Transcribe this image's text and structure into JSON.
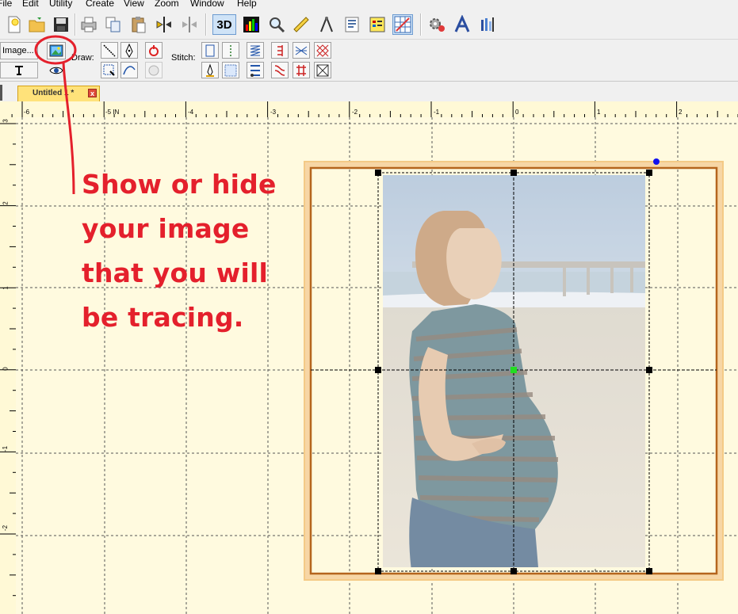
{
  "menu": [
    "File",
    "Edit",
    "Utility",
    "Create",
    "View",
    "Zoom",
    "Window",
    "Help"
  ],
  "toolbar": {
    "toggle_3d_label": "3D",
    "icons": [
      "new-file-icon",
      "open-folder-icon",
      "save-icon",
      "print-icon",
      "copy-icon",
      "paste-icon",
      "mirror-horizontal-icon",
      "mirror-vertical-icon",
      "3d-view-icon",
      "color-chart-icon",
      "zoom-magnifier-icon",
      "ruler-measure-icon",
      "compass-icon",
      "design-info-icon",
      "grid-icon",
      "settings-gear-icon",
      "font-icon",
      "color-pencils-icon"
    ]
  },
  "toolbar2": {
    "image_button_label": "Image...",
    "draw_label": "Draw:",
    "stitch_label": "Stitch:"
  },
  "tab": {
    "title": "Untitled 1 *",
    "close_glyph": "x"
  },
  "ruler": {
    "horizontal_labels": [
      "-6",
      "-5 IN",
      "-4",
      "-3",
      "-2",
      "-1",
      "0",
      "1",
      "2"
    ],
    "vertical_labels": [
      "3",
      "2",
      "1",
      "0",
      "-1",
      "-2"
    ]
  },
  "annotation": {
    "lines": [
      "Show or hide",
      "your image",
      "that you will",
      "be tracing."
    ],
    "color": "#e4202c"
  },
  "colors": {
    "canvas": "#fffadf",
    "hoop_frame": "#f7d6a5",
    "hoop_border": "#b5651d",
    "selection_handle": "#000000",
    "center_handle": "#22dd22",
    "rotate_handle": "#1010ee"
  }
}
